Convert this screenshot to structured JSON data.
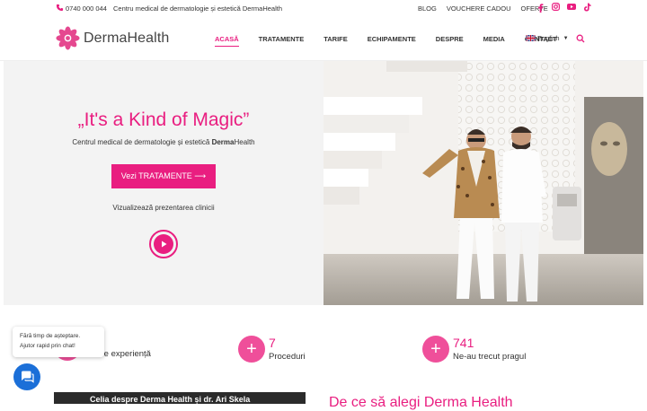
{
  "topbar": {
    "phone": "0740 000 044",
    "tagline": "Centru medical de dermatologie și estetică DermaHealth",
    "links": [
      "BLOG",
      "VOUCHERE CADOU",
      "OFERTE"
    ],
    "social_icons": [
      "facebook-icon",
      "instagram-icon",
      "youtube-icon",
      "tiktok-icon"
    ]
  },
  "header": {
    "logo_text": "DermaHealth",
    "nav": [
      "ACASĂ",
      "TRATAMENTE",
      "TARIFE",
      "ECHIPAMENTE",
      "DESPRE",
      "MEDIA",
      "CONTACT"
    ],
    "active": "ACASĂ",
    "language": "English"
  },
  "hero": {
    "title": "„It's a Kind of Magic”",
    "subtitle_prefix": "Centrul medical de dermatologie și estetică ",
    "subtitle_brand": "Derma",
    "subtitle_brand_rest": "Health",
    "cta": "Vezi TRATAMENTE ⟶",
    "video_label": "Vizualizează prezentarea clinicii"
  },
  "stats": [
    {
      "number": "",
      "label": "Ani de experiență"
    },
    {
      "number": "7",
      "label": "Proceduri"
    },
    {
      "number": "741",
      "label": "Ne-au trecut pragul"
    }
  ],
  "chat": {
    "line1": "Fără timp de așteptare.",
    "line2": "Ajutor rapid prin chat!"
  },
  "bottom": {
    "video_title": "Celia despre Derma Health și dr. Ari Skela",
    "heading": "De ce să alegi Derma Health"
  },
  "colors": {
    "accent": "#e91e80",
    "chat": "#1b6fd8"
  }
}
